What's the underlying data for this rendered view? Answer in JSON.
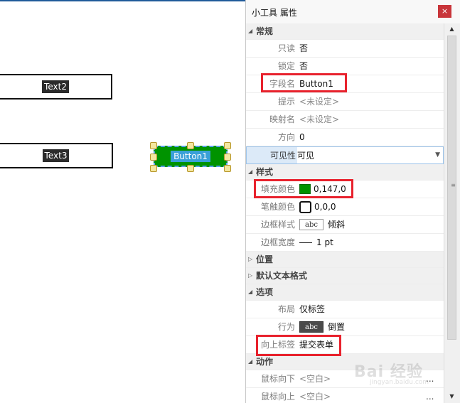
{
  "canvas": {
    "text2_label": "Text2",
    "text3_label": "Text3",
    "button_label": "Button1"
  },
  "panel": {
    "title": "小工具 属性",
    "close_glyph": "×"
  },
  "sections": {
    "general": "常规",
    "style": "样式",
    "position": "位置",
    "default_text": "默认文本格式",
    "options": "选项",
    "action": "动作"
  },
  "props": {
    "readonly_label": "只读",
    "readonly_value": "否",
    "locked_label": "锁定",
    "locked_value": "否",
    "fieldname_label": "字段名",
    "fieldname_value": "Button1",
    "tip_label": "提示",
    "tip_value": "<未设定>",
    "mapname_label": "映射名",
    "mapname_value": "<未设定>",
    "direction_label": "方向",
    "direction_value": "0",
    "visibility_label": "可见性",
    "visibility_value": "可见",
    "fill_label": "填充颜色",
    "fill_value": "0,147,0",
    "stroke_label": "笔触颜色",
    "stroke_value": "0,0,0",
    "border_style_label": "边框样式",
    "border_style_value": "倾斜",
    "border_width_label": "边框宽度",
    "border_width_value": "1 pt",
    "layout_label": "布局",
    "layout_value": "仅标签",
    "behavior_label": "行为",
    "behavior_value": "倒置",
    "up_label_label": "向上标签",
    "up_label_value": "提交表单",
    "mouse_down_label": "鼠标向下",
    "mouse_down_value": "<空白>",
    "mouse_up_label": "鼠标向上",
    "mouse_up_value": "<空白>",
    "abc_text": "abc",
    "ellipsis": "..."
  },
  "colors": {
    "fill_swatch": "#009300",
    "highlight": "#e8222d",
    "accent": "#1f5b9a"
  },
  "watermark": {
    "brand": "Bai 经验",
    "sub": "jingyan.baidu.com"
  }
}
